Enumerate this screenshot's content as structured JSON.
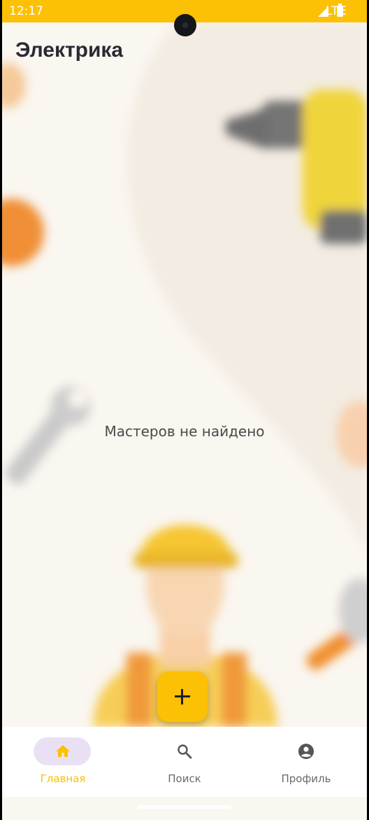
{
  "status_bar": {
    "time": "12:17",
    "network": "LTE",
    "icons": [
      "signal-icon",
      "battery-icon"
    ]
  },
  "header": {
    "title": "Электрика"
  },
  "main": {
    "empty_message": "Мастеров не найдено",
    "background_illustration": [
      "drill",
      "wrench",
      "builder-in-hard-hat",
      "paintbrush"
    ]
  },
  "fab": {
    "icon": "plus-icon"
  },
  "bottom_nav": {
    "items": [
      {
        "label": "Главная",
        "icon": "home-icon",
        "active": true
      },
      {
        "label": "Поиск",
        "icon": "search-icon",
        "active": false
      },
      {
        "label": "Профиль",
        "icon": "account-circle-icon",
        "active": false
      }
    ]
  },
  "colors": {
    "accent": "#fcc004",
    "background": "#faf6f0",
    "nav_pill": "#e9e1f3",
    "title_text": "#2b2a33"
  }
}
